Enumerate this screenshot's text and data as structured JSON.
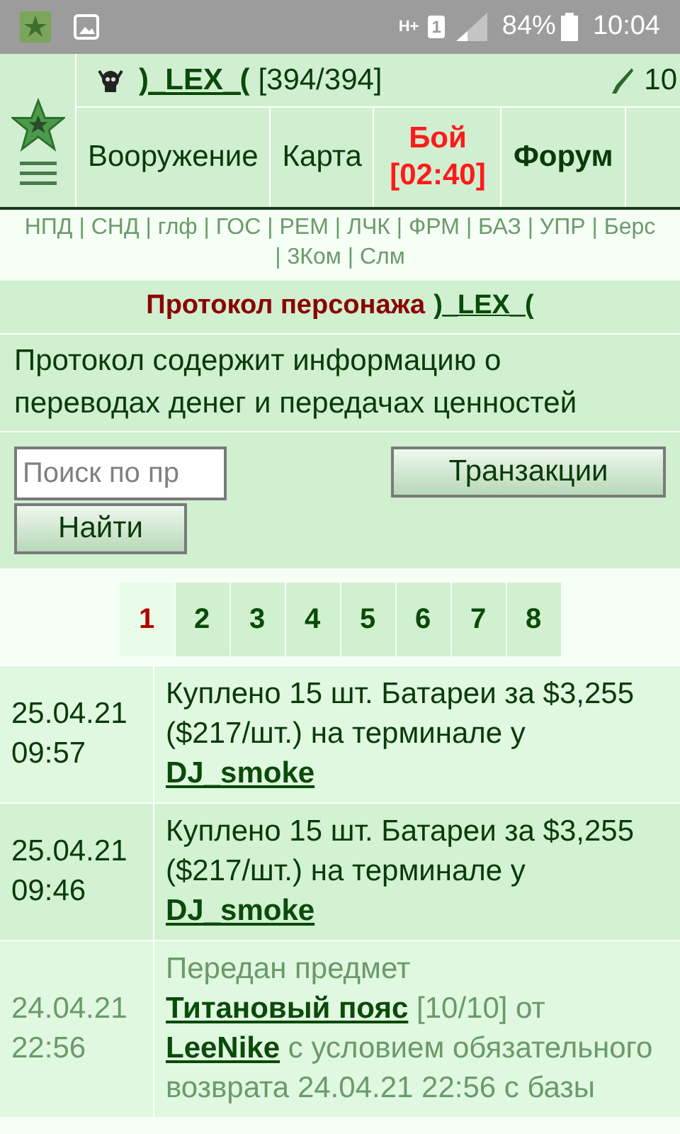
{
  "status_bar": {
    "network": "H+",
    "sim": "1",
    "battery": "84%",
    "time": "10:04"
  },
  "header": {
    "player": ")_LEX_(",
    "hp": "[394/394]",
    "extra": "10"
  },
  "nav": [
    {
      "label": "Вооружение",
      "kind": "normal"
    },
    {
      "label": "Карта",
      "kind": "normal"
    },
    {
      "label": "Бой [02:40]",
      "kind": "alert"
    },
    {
      "label": "Форум",
      "kind": "bold"
    }
  ],
  "quick_link_separator": "|",
  "quick_links": [
    "НПД",
    "СНД",
    "глф",
    "ГОС",
    "РЕМ",
    "ЛЧК",
    "ФРМ",
    "БАЗ",
    "УПР",
    "Берс",
    "3Ком",
    "Слм"
  ],
  "title": {
    "text": "Протокол персонажа",
    "player": ")_LEX_("
  },
  "description": "Протокол содержит информацию о переводах денег и передачах ценностей",
  "search": {
    "placeholder": "Поиск по пр",
    "find_button": "Найти",
    "transactions_button": "Транзакции"
  },
  "pages": [
    {
      "label": "1",
      "selected": true
    },
    {
      "label": "2",
      "selected": false
    },
    {
      "label": "3",
      "selected": false
    },
    {
      "label": "4",
      "selected": false
    },
    {
      "label": "5",
      "selected": false
    },
    {
      "label": "6",
      "selected": false
    },
    {
      "label": "7",
      "selected": false
    },
    {
      "label": "8",
      "selected": false
    }
  ],
  "log": [
    {
      "date": "25.04.21",
      "time": "09:57",
      "dimmed": false,
      "parts": [
        {
          "kind": "text",
          "text": "Куплено 15 шт. Батареи за $3,255 ($217/шт.) на терминале у "
        },
        {
          "kind": "link",
          "text": "DJ_smoke"
        }
      ]
    },
    {
      "date": "25.04.21",
      "time": "09:46",
      "dimmed": false,
      "parts": [
        {
          "kind": "text",
          "text": "Куплено 15 шт. Батареи за $3,255 ($217/шт.) на терминале у "
        },
        {
          "kind": "link",
          "text": "DJ_smoke"
        }
      ]
    },
    {
      "date": "24.04.21",
      "time": "22:56",
      "dimmed": true,
      "parts": [
        {
          "kind": "text",
          "text": "Передан предмет "
        },
        {
          "kind": "link",
          "text": "Титановый пояс"
        },
        {
          "kind": "text",
          "text": " [10/10] от "
        },
        {
          "kind": "link",
          "text": "LeeNike"
        },
        {
          "kind": "text",
          "text": " с условием обязательного возврата 24.04.21 22:56 с базы"
        }
      ]
    }
  ]
}
